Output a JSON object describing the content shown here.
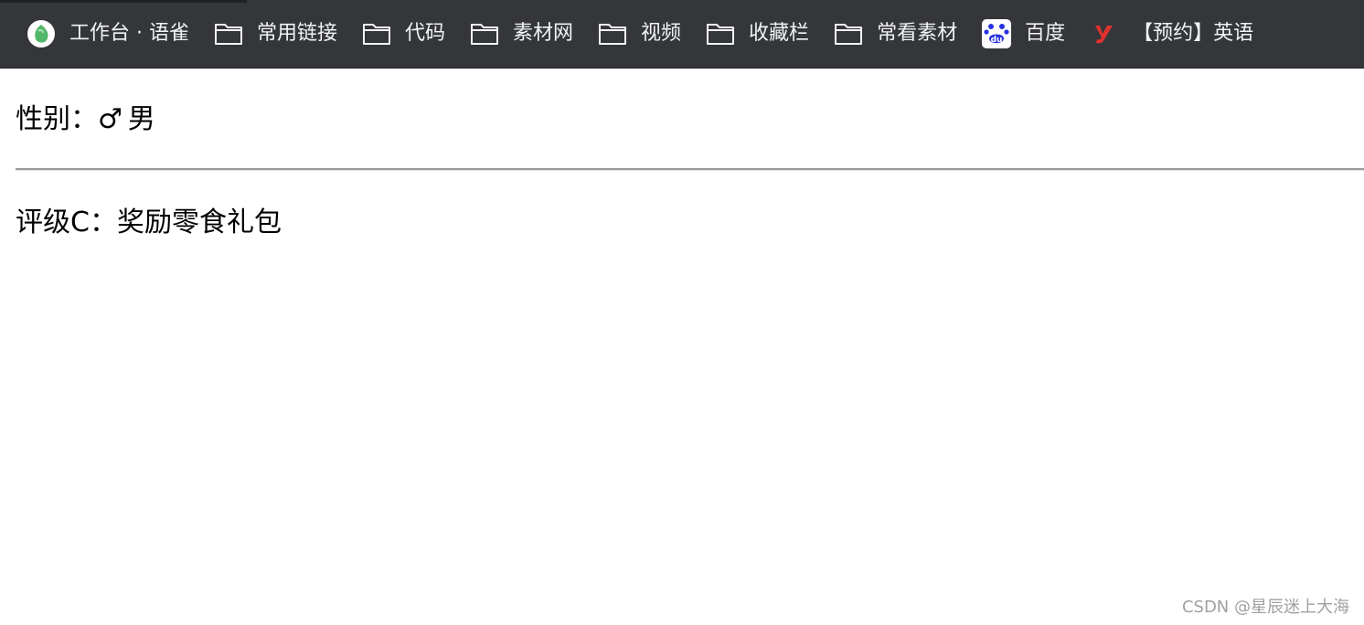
{
  "bookmarks": [
    {
      "label": "工作台 · 语雀",
      "icon": "yuque-logo-icon"
    },
    {
      "label": "常用链接",
      "icon": "folder-icon"
    },
    {
      "label": "代码",
      "icon": "folder-icon"
    },
    {
      "label": "素材网",
      "icon": "folder-icon"
    },
    {
      "label": "视频",
      "icon": "folder-icon"
    },
    {
      "label": "收藏栏",
      "icon": "folder-icon"
    },
    {
      "label": "常看素材",
      "icon": "folder-icon"
    },
    {
      "label": "百度",
      "icon": "baidu-logo-icon"
    },
    {
      "label": "【预约】英语",
      "icon": "y-logo-icon"
    }
  ],
  "content": {
    "gender_label": "性别：",
    "gender_symbol": "♂",
    "gender_value": "男",
    "rating_text": "评级C：奖励零食礼包"
  },
  "watermark": "CSDN @星辰迷上大海",
  "colors": {
    "bar_bg": "#35363a",
    "bar_text": "#f1f3f4",
    "yuque_green": "#53b76b",
    "baidu_blue": "#2932e1",
    "y_red": "#e0312f"
  }
}
